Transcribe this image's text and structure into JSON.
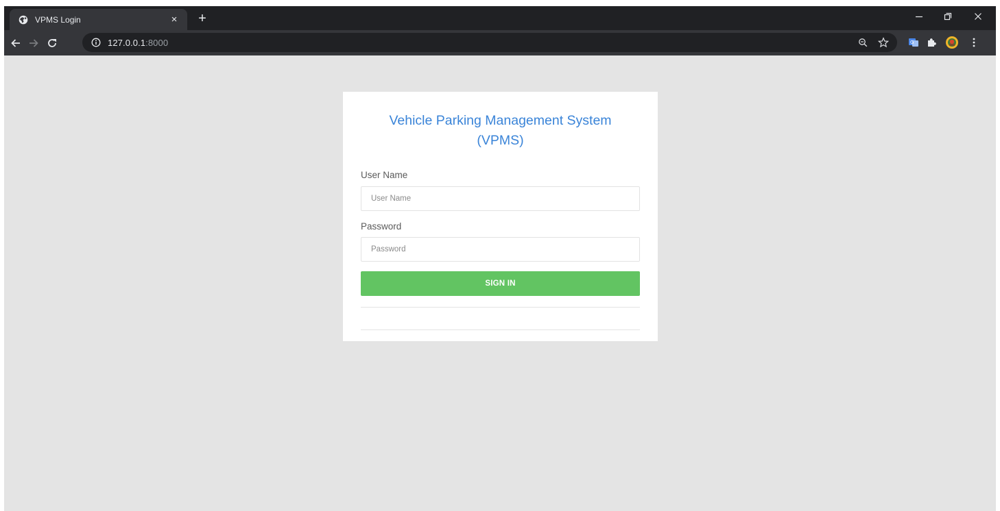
{
  "browser": {
    "tab_title": "VPMS Login",
    "tab_close": "×",
    "new_tab": "+",
    "url_host": "127.0.0.1",
    "url_port": ":8000",
    "icons": {
      "favicon": "globe-icon",
      "info": "info-icon",
      "back": "arrow-left-icon",
      "forward": "arrow-right-icon",
      "reload": "reload-icon",
      "zoom": "zoom-icon",
      "bookmark": "star-icon",
      "translate": "translate-extension-icon",
      "extensions": "puzzle-icon",
      "profile": "profile-avatar",
      "menu": "kebab-menu-icon",
      "minimize": "minimize-icon",
      "restore": "restore-icon",
      "close": "close-icon"
    }
  },
  "login": {
    "title_line1": "Vehicle Parking Management System",
    "title_line2": "(VPMS)",
    "username_label": "User Name",
    "username_placeholder": "User Name",
    "username_value": "",
    "password_label": "Password",
    "password_placeholder": "Password",
    "password_value": "",
    "signin_label": "SIGN IN"
  },
  "colors": {
    "page_background": "#e4e4e4",
    "title_blue": "#3a84d8",
    "signin_green": "#62c462",
    "chrome_dark": "#202124",
    "chrome_toolbar": "#35363a"
  }
}
